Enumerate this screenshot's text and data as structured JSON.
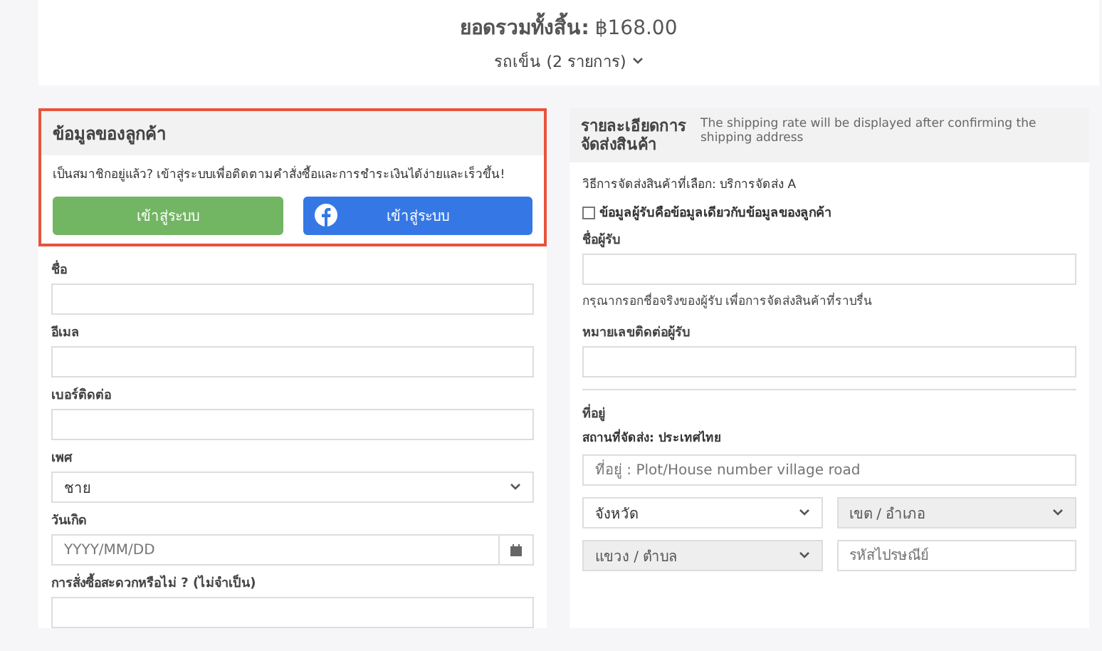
{
  "summary": {
    "total_label": "ยอดรวมทั้งสิ้น:",
    "total_value": "฿168.00",
    "cart_toggle": "รถเข็น (2 รายการ)",
    "expanded": false
  },
  "customer": {
    "title": "ข้อมูลของลูกค้า",
    "member_text": "เป็นสมาชิกอยู่แล้ว? เข้าสู่ระบบเพื่อติดตามคำสั่งซื้อและการชำระเงินได้ง่ายและเร็วขึ้น!",
    "login_buttons": [
      {
        "kind": "site",
        "label": "เข้าสู่ระบบ"
      },
      {
        "kind": "facebook",
        "label": "เข้าสู่ระบบ"
      }
    ],
    "fields": [
      {
        "kind": "text",
        "label": "ชื่อ"
      },
      {
        "kind": "text",
        "label": "อีเมล"
      },
      {
        "kind": "text",
        "label": "เบอร์ติดต่อ"
      },
      {
        "kind": "select",
        "label": "เพศ",
        "value": "ชาย"
      },
      {
        "kind": "date",
        "label": "วันเกิด",
        "placeholder": "YYYY/MM/DD"
      },
      {
        "kind": "text",
        "label": "การสั่งซื้อสะดวกหรือไม่ ? (ไม่จำเป็น)"
      }
    ]
  },
  "shipping": {
    "title": "รายละเอียดการจัดส่งสินค้า",
    "note": "The shipping rate will be displayed after confirming the shipping address",
    "method": "วิธีการจัดส่งสินค้าที่เลือก: บริการจัดส่ง A",
    "same_as_customer": {
      "label": "ข้อมูลผู้รับคือข้อมูลเดียวกับข้อมูลของลูกค้า",
      "checked": false
    },
    "recipient_label": "ชื่อผู้รับ",
    "recipient_hint": "กรุณากรอกชื่อจริงของผู้รับ เพื่อการจัดส่งสินค้าที่ราบรื่น",
    "phone_label": "หมายเลขติดต่อผู้รับ",
    "address_label": "ที่อยู่",
    "country": "สถานที่จัดส่ง: ประเทศไทย",
    "address_placeholder": "ที่อยู่ : Plot/House number village road",
    "address_parts": [
      {
        "kind": "select",
        "value": "จังหวัด",
        "disabled": false
      },
      {
        "kind": "select",
        "value": "เขต / อำเภอ",
        "disabled": true
      },
      {
        "kind": "select",
        "value": "แขวง / ตำบล",
        "disabled": true
      },
      {
        "kind": "text",
        "placeholder": "รหัสไปรษณีย์",
        "disabled": false
      }
    ]
  }
}
